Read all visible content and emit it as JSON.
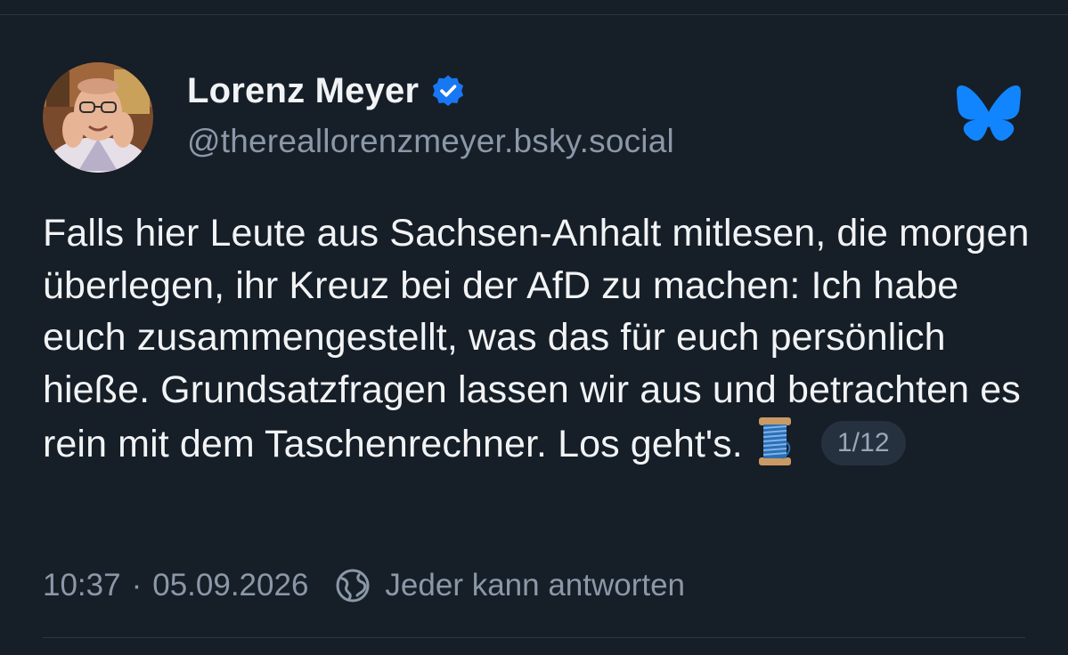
{
  "post": {
    "author": {
      "name": "Lorenz Meyer",
      "handle": "@thereallorenzmeyer.bsky.social",
      "verified": true
    },
    "platform_icon": "bluesky-butterfly-icon",
    "text_main": "Falls hier Leute aus Sachsen-Anhalt mitlesen, die morgen überlegen, ihr Kreuz bei der AfD zu machen: Ich habe euch zusammengestellt, was das für euch persönlich hieße. Grundsatzfragen lassen wir aus und betrachten es rein mit dem Taschenrechner. Los geht's.",
    "emoji": "thread-spool-emoji",
    "thread_count": "1/12",
    "time": "10:37",
    "separator": "·",
    "date": "05.09.2026",
    "reply_setting": "Jeder kann antworten"
  },
  "colors": {
    "background": "#161e27",
    "text": "#f1f3f5",
    "muted": "#8b98a8",
    "verified": "#1877f2",
    "bluesky": "#1185fe",
    "pill": "#263140"
  }
}
